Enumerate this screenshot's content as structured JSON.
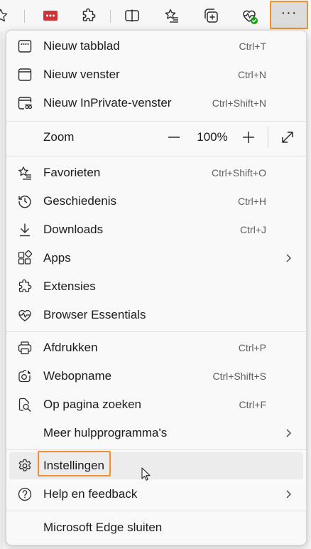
{
  "toolbar": {
    "icons": [
      "star-icon",
      "red-extension-icon",
      "puzzle-icon",
      "split-screen-icon",
      "favorites-icon",
      "collections-icon",
      "browser-essentials-icon",
      "more-icon"
    ],
    "more_label": "···"
  },
  "menu": {
    "items": [
      {
        "label": "Nieuw tabblad",
        "shortcut": "Ctrl+T"
      },
      {
        "label": "Nieuw venster",
        "shortcut": "Ctrl+N"
      },
      {
        "label": "Nieuw InPrivate-venster",
        "shortcut": "Ctrl+Shift+N"
      },
      {
        "label": "Zoom",
        "shortcut": ""
      },
      {
        "label": "Favorieten",
        "shortcut": "Ctrl+Shift+O"
      },
      {
        "label": "Geschiedenis",
        "shortcut": "Ctrl+H"
      },
      {
        "label": "Downloads",
        "shortcut": "Ctrl+J"
      },
      {
        "label": "Apps",
        "shortcut": ""
      },
      {
        "label": "Extensies",
        "shortcut": ""
      },
      {
        "label": "Browser Essentials",
        "shortcut": ""
      },
      {
        "label": "Afdrukken",
        "shortcut": "Ctrl+P"
      },
      {
        "label": "Webopname",
        "shortcut": "Ctrl+Shift+S"
      },
      {
        "label": "Op pagina zoeken",
        "shortcut": "Ctrl+F"
      },
      {
        "label": "Meer hulpprogramma's",
        "shortcut": ""
      },
      {
        "label": "Instellingen",
        "shortcut": ""
      },
      {
        "label": "Help en feedback",
        "shortcut": ""
      },
      {
        "label": "Microsoft Edge sluiten",
        "shortcut": ""
      }
    ],
    "zoom": {
      "value": "100%",
      "minus": "−",
      "plus": "+"
    }
  },
  "colors": {
    "highlight_border": "#f0902f",
    "hover_bg": "#ececec",
    "check_green": "#13a10e",
    "ext_red": "#d13438"
  }
}
